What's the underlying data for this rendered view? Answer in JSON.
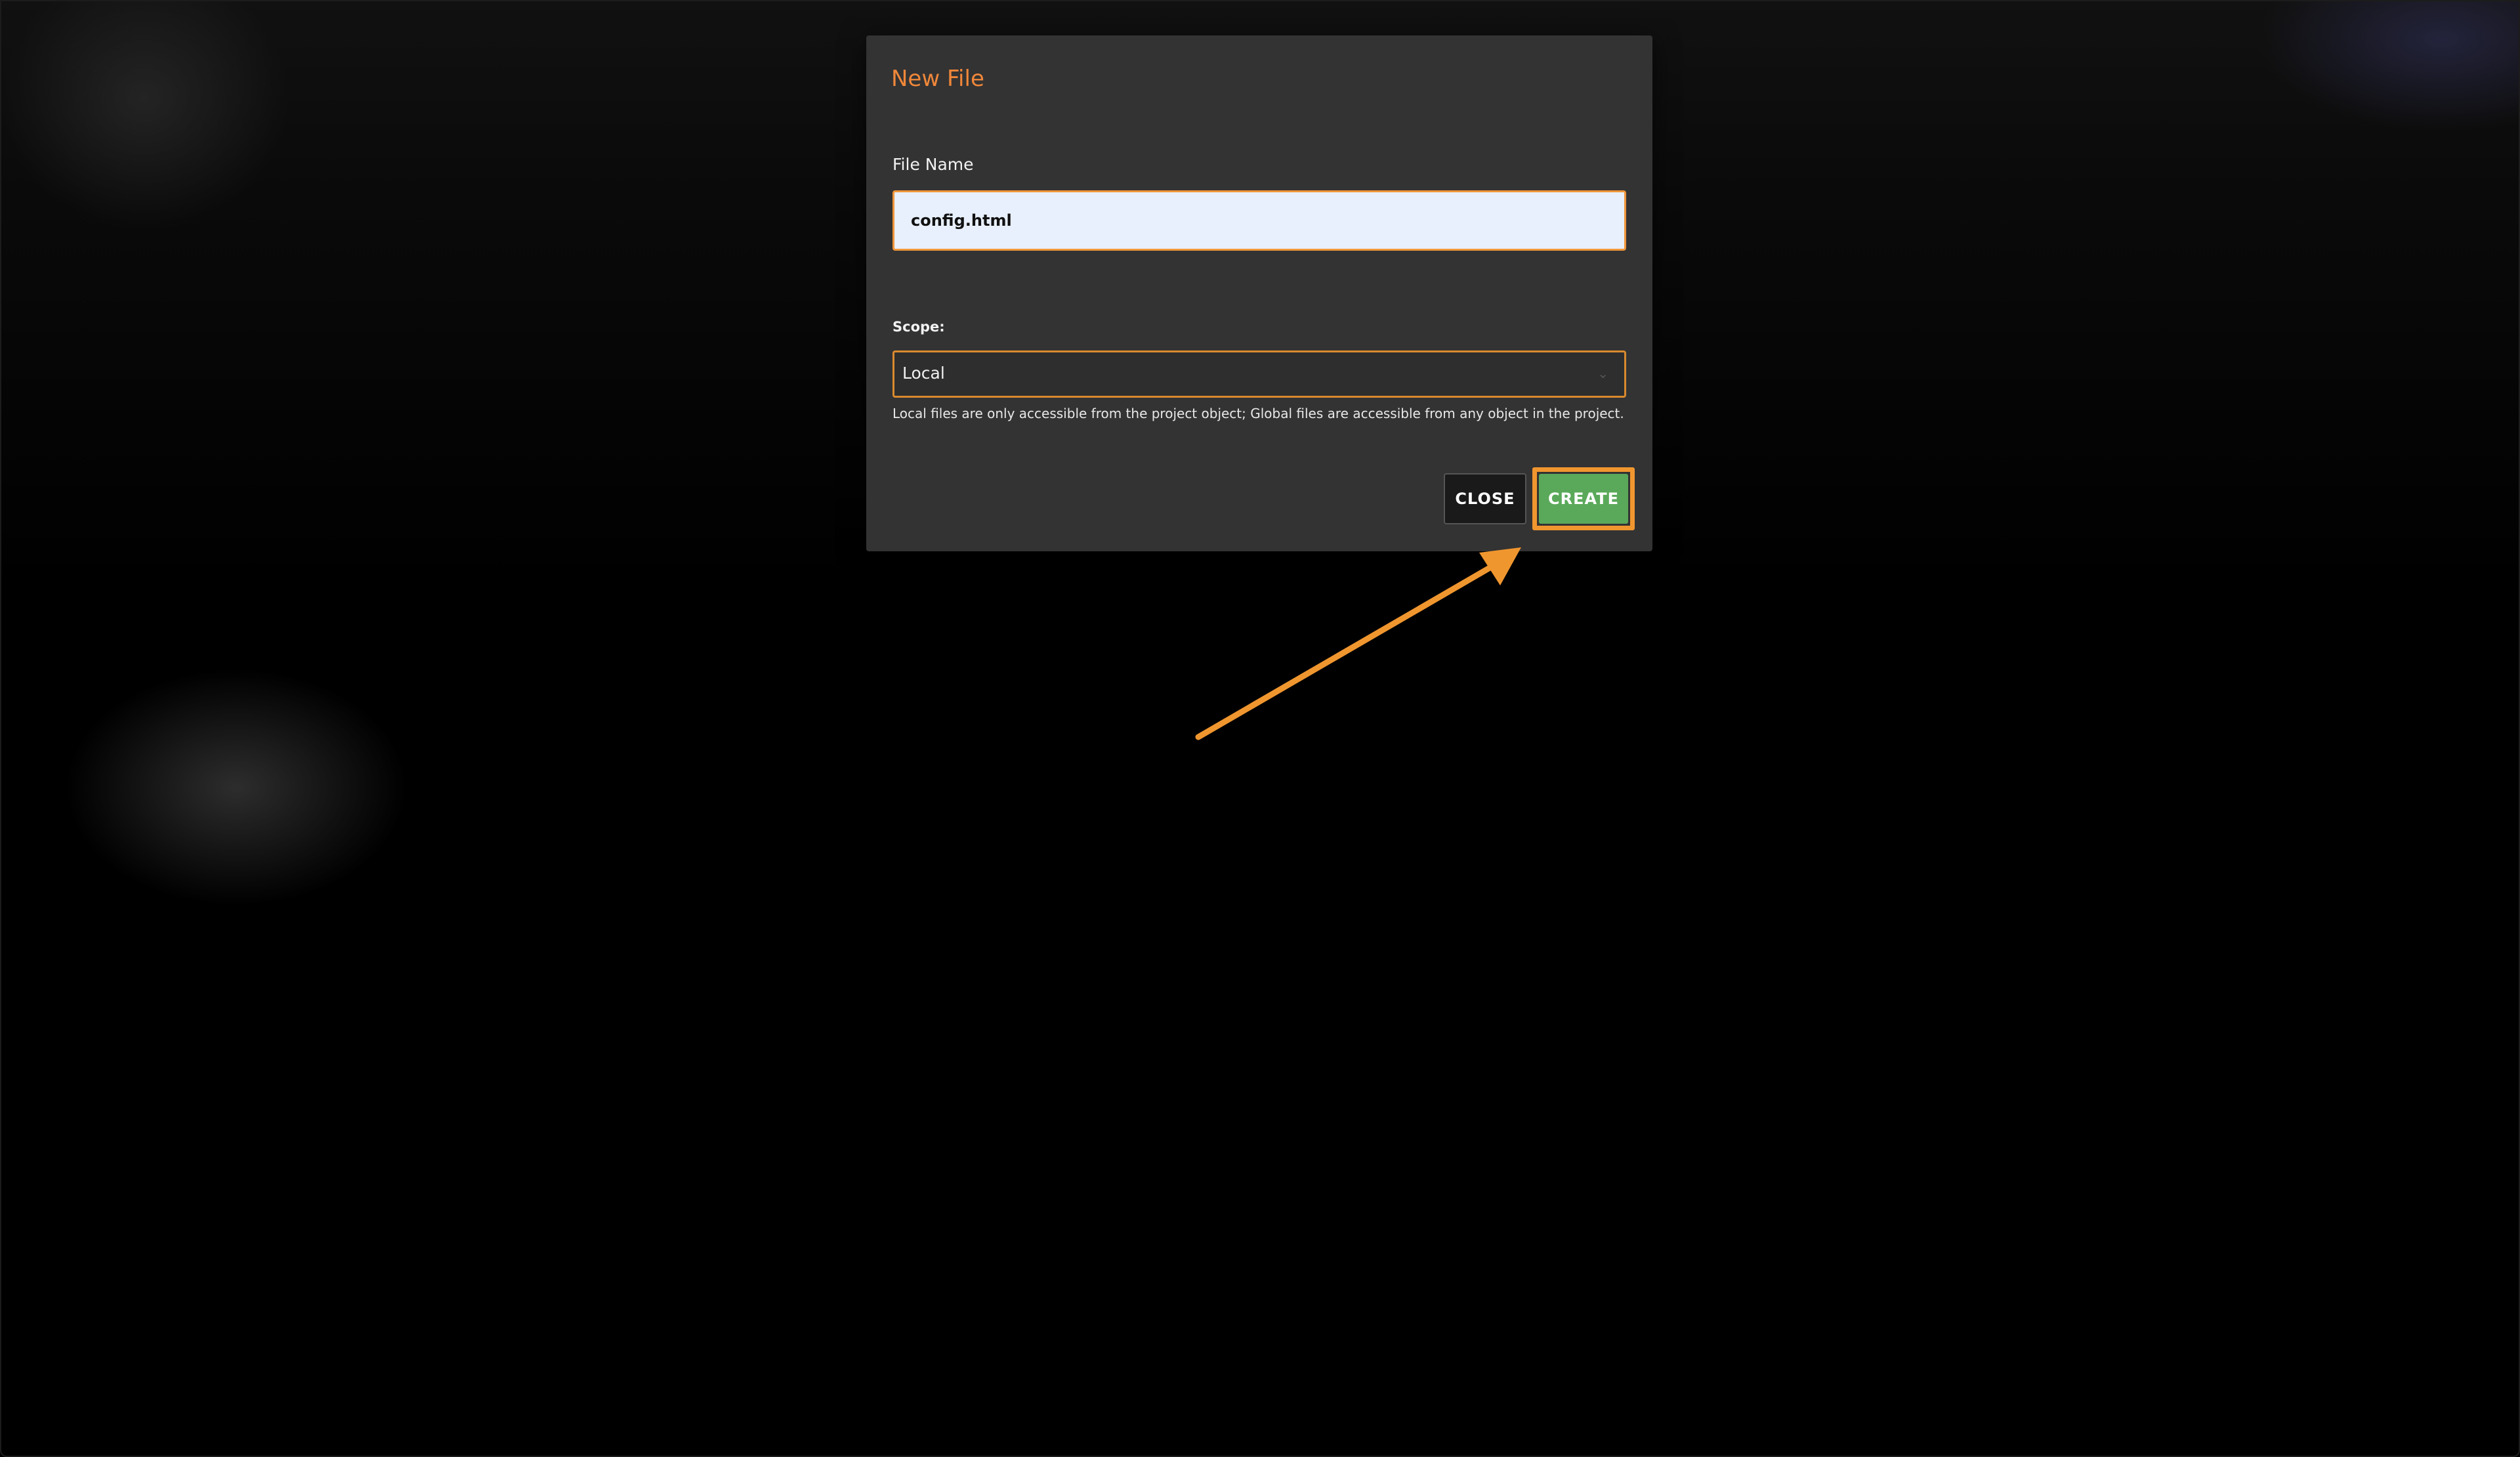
{
  "dialog": {
    "title": "New File",
    "file_name_label": "File Name",
    "file_name_value": "config.html",
    "scope_label": "Scope:",
    "scope_selected": "Local",
    "scope_caret_icon": "chevron-down-icon",
    "help_text": "Local files are only accessible from the project object; Global files are accessible from any object in the project.",
    "close_label": "CLOSE",
    "create_label": "CREATE"
  },
  "colors": {
    "accent_orange": "#f0962f",
    "create_green": "#5aa95a",
    "dialog_bg": "#333333",
    "input_bg": "#e8f0fe"
  },
  "annotation": {
    "type": "arrow",
    "color": "#f0962f",
    "target": "create-button"
  }
}
